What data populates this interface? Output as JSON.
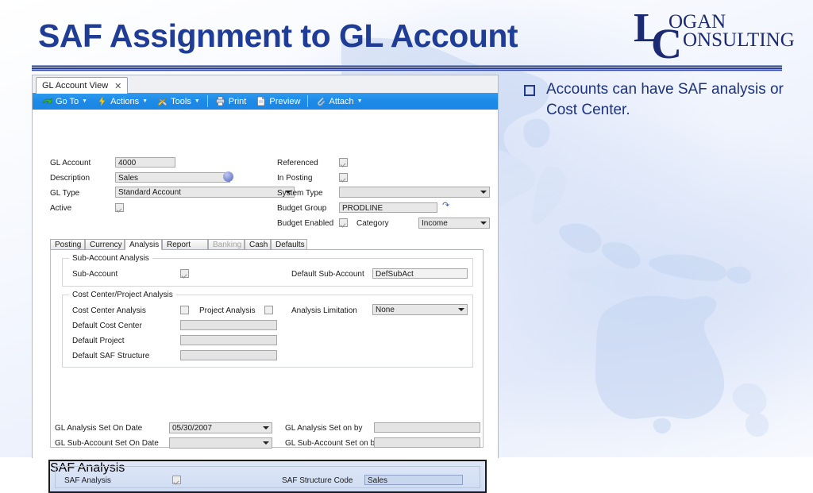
{
  "slide": {
    "title": "SAF Assignment to GL Account",
    "logo": {
      "line1": "LOGAN",
      "line2": "CONSULTING",
      "big_l": "L",
      "big_c": "C"
    },
    "bullet": {
      "marker": "square-bullet",
      "text": "Accounts can have SAF analysis or Cost Center."
    }
  },
  "app": {
    "tab": {
      "label": "GL Account View",
      "close": "✕"
    },
    "toolbar": [
      {
        "label": "Go To",
        "icon": "go-to-arrow-icon",
        "caret": "▼"
      },
      {
        "label": "Actions",
        "icon": "lightning-icon",
        "caret": "▼"
      },
      {
        "label": "Tools",
        "icon": "tools-icon",
        "caret": "▼"
      },
      {
        "label": "Print",
        "icon": "printer-icon",
        "caret": ""
      },
      {
        "label": "Preview",
        "icon": "preview-page-icon",
        "caret": ""
      },
      {
        "label": "Attach",
        "icon": "paperclip-icon",
        "caret": "▼"
      }
    ],
    "header_left": {
      "gl_account": {
        "label": "GL Account",
        "value": "4000"
      },
      "description": {
        "label": "Description",
        "value": "Sales",
        "icon": "globe-icon"
      },
      "gl_type": {
        "label": "GL Type",
        "value": "Standard Account"
      },
      "active": {
        "label": "Active",
        "checked": true
      }
    },
    "header_right": {
      "referenced": {
        "label": "Referenced",
        "checked": true
      },
      "in_posting": {
        "label": "In Posting",
        "checked": true
      },
      "system_type": {
        "label": "System Type",
        "value": ""
      },
      "budget_group": {
        "label": "Budget Group",
        "value": "PRODLINE",
        "icon": "link-icon"
      },
      "budget_enabled": {
        "label": "Budget Enabled",
        "checked": true
      },
      "category": {
        "label": "Category",
        "value": "Income"
      }
    },
    "tabs": [
      {
        "label": "Posting",
        "state": "normal"
      },
      {
        "label": "Currency",
        "state": "normal"
      },
      {
        "label": "Analysis",
        "state": "active"
      },
      {
        "label": "Report Link",
        "state": "normal"
      },
      {
        "label": "Banking",
        "state": "disabled"
      },
      {
        "label": "Cash",
        "state": "normal"
      },
      {
        "label": "Defaults",
        "state": "normal"
      }
    ],
    "sub_account_analysis": {
      "group_title": "Sub-Account Analysis",
      "sub_account": {
        "label": "Sub-Account",
        "checked": true
      },
      "default_sub_account": {
        "label": "Default Sub-Account",
        "value": "DefSubAct"
      }
    },
    "cost_center_project_analysis": {
      "group_title": "Cost Center/Project Analysis",
      "cost_center_analysis": {
        "label": "Cost Center Analysis",
        "checked": false
      },
      "project_analysis": {
        "label": "Project Analysis",
        "checked": false
      },
      "analysis_limitation": {
        "label": "Analysis Limitation",
        "value": "None"
      },
      "default_cost_center": {
        "label": "Default Cost Center",
        "value": ""
      },
      "default_project": {
        "label": "Default Project",
        "value": ""
      },
      "default_saf_structure": {
        "label": "Default SAF Structure",
        "value": ""
      }
    },
    "saf_analysis": {
      "group_title": "SAF Analysis",
      "saf_analysis": {
        "label": "SAF Analysis",
        "checked": true
      },
      "saf_structure_code": {
        "label": "SAF Structure Code",
        "value": "Sales"
      }
    },
    "footer": {
      "gl_analysis_set_on_date": {
        "label": "GL Analysis Set On Date",
        "value": "05/30/2007"
      },
      "gl_analysis_set_on_by": {
        "label": "GL Analysis Set on by",
        "value": ""
      },
      "gl_sub_account_set_on_date": {
        "label": "GL Sub-Account Set On Date",
        "value": ""
      },
      "gl_sub_account_set_on_by": {
        "label": "GL Sub-Account Set on by",
        "value": ""
      }
    }
  },
  "colors": {
    "title": "#1f3c96",
    "toolbar": "#1d8ae8",
    "highlight_border": "#1a1a1a"
  }
}
